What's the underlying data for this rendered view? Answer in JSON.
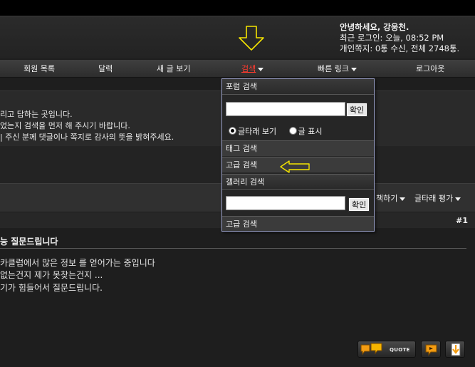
{
  "header": {
    "greeting": "안녕하세요, 강웅천.",
    "last_login": "최근 로그인: 오늘, 08:52 PM",
    "messages": "개인쪽지: 0통 수신, 전체 2748통."
  },
  "nav": {
    "items": [
      {
        "label": "회원 목록"
      },
      {
        "label": "달력"
      },
      {
        "label": "새 글 보기"
      },
      {
        "label": "검색"
      },
      {
        "label": "빠른 링크"
      },
      {
        "label": "로그아웃"
      }
    ]
  },
  "notice": {
    "lines": [
      "리고 답하는 곳입니다.",
      "었는지 검색을 먼저 해 주시기 바랍니다.",
      "| 주신 분께 댓글이나 쪽지로 감사의 뜻을 밝혀주세요."
    ]
  },
  "post_toolbar": {
    "tools": "책하기",
    "rate": "글타래 평가"
  },
  "post": {
    "number": "#1",
    "title": "능 질문드립니다",
    "lines": [
      "카클럽에서 많은 정보 를 얻어가는 중입니다",
      "없는건지 제가 못찾는건지 ...",
      "기가 힘들어서 질문드립니다."
    ]
  },
  "buttons": {
    "quote": "QUOTE"
  },
  "search_dropdown": {
    "forum_search": "포럼 검색",
    "confirm": "확인",
    "radio_threads": "글타래 보기",
    "radio_posts": "글 표시",
    "tag_search": "태그 검색",
    "advanced_search": "고급 검색",
    "gallery_search": "갤러리 검색",
    "gallery_advanced": "고급 검색"
  },
  "colors": {
    "arrow": "#f5e400",
    "active_nav": "#ff3b2f",
    "dropdown_border": "#9aa0c8"
  }
}
